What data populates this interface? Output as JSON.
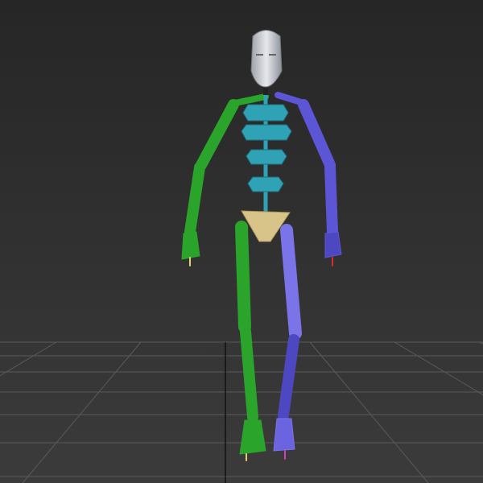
{
  "viewport": {
    "background_top": "#262626",
    "background_bottom": "#3b3b3b",
    "grid_color": "#5a5a5a"
  },
  "biped": {
    "head_color": "#c9ccd3",
    "spine_color": "#2fa3b5",
    "pelvis_color": "#d8c489",
    "left_side_color": "#2aa42a",
    "right_side_color": "#5c56d6"
  }
}
